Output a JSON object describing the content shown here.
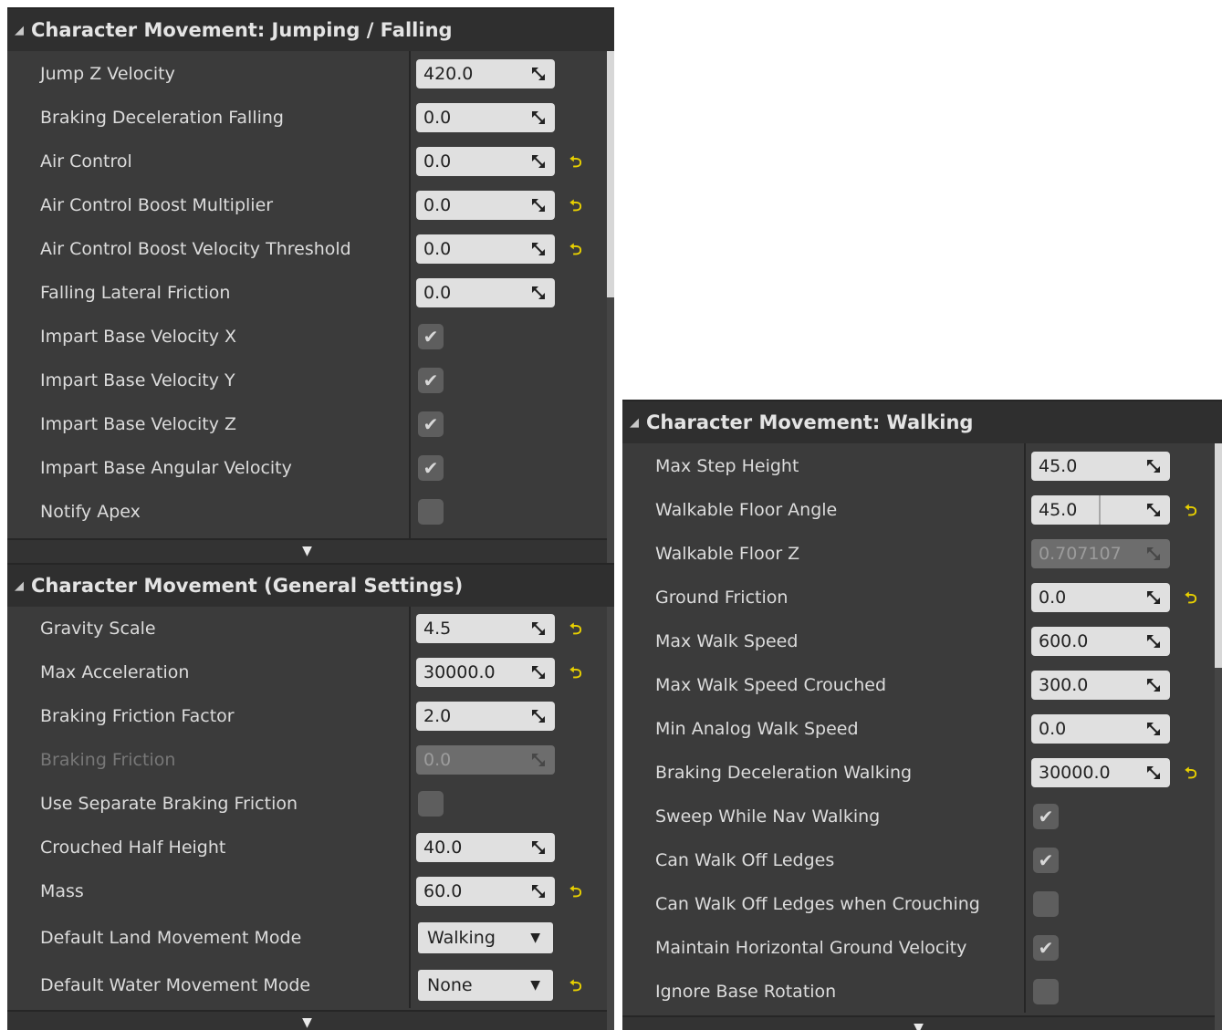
{
  "jumping": {
    "title": "Character Movement: Jumping / Falling",
    "rows": {
      "jump_z_velocity": {
        "label": "Jump Z Velocity",
        "value": "420.0"
      },
      "braking_decel_falling": {
        "label": "Braking Deceleration Falling",
        "value": "0.0"
      },
      "air_control": {
        "label": "Air Control",
        "value": "0.0"
      },
      "air_control_boost_mult": {
        "label": "Air Control Boost Multiplier",
        "value": "0.0"
      },
      "air_control_boost_vel": {
        "label": "Air Control Boost Velocity Threshold",
        "value": "0.0"
      },
      "falling_lateral_friction": {
        "label": "Falling Lateral Friction",
        "value": "0.0"
      },
      "impart_x": {
        "label": "Impart Base Velocity X",
        "checked": true
      },
      "impart_y": {
        "label": "Impart Base Velocity Y",
        "checked": true
      },
      "impart_z": {
        "label": "Impart Base Velocity Z",
        "checked": true
      },
      "impart_angular": {
        "label": "Impart Base Angular Velocity",
        "checked": true
      },
      "notify_apex": {
        "label": "Notify Apex",
        "checked": false
      }
    }
  },
  "general": {
    "title": "Character Movement (General Settings)",
    "rows": {
      "gravity_scale": {
        "label": "Gravity Scale",
        "value": "4.5"
      },
      "max_acceleration": {
        "label": "Max Acceleration",
        "value": "30000.0"
      },
      "braking_friction_factor": {
        "label": "Braking Friction Factor",
        "value": "2.0"
      },
      "braking_friction": {
        "label": "Braking Friction",
        "value": "0.0",
        "disabled": true
      },
      "use_separate_braking": {
        "label": "Use Separate Braking Friction",
        "checked": false
      },
      "crouched_half_height": {
        "label": "Crouched Half Height",
        "value": "40.0"
      },
      "mass": {
        "label": "Mass",
        "value": "60.0"
      },
      "default_land_mode": {
        "label": "Default Land Movement Mode",
        "value": "Walking"
      },
      "default_water_mode": {
        "label": "Default Water Movement Mode",
        "value": "None"
      }
    }
  },
  "walking": {
    "title": "Character Movement: Walking",
    "rows": {
      "max_step_height": {
        "label": "Max Step Height",
        "value": "45.0"
      },
      "walkable_floor_angle": {
        "label": "Walkable Floor Angle",
        "value": "45.0"
      },
      "walkable_floor_z": {
        "label": "Walkable Floor Z",
        "value": "0.707107",
        "disabled": true
      },
      "ground_friction": {
        "label": "Ground Friction",
        "value": "0.0"
      },
      "max_walk_speed": {
        "label": "Max Walk Speed",
        "value": "600.0"
      },
      "max_walk_speed_crouched": {
        "label": "Max Walk Speed Crouched",
        "value": "300.0"
      },
      "min_analog_walk_speed": {
        "label": "Min Analog Walk Speed",
        "value": "0.0"
      },
      "braking_decel_walking": {
        "label": "Braking Deceleration Walking",
        "value": "30000.0"
      },
      "sweep_nav_walking": {
        "label": "Sweep While Nav Walking",
        "checked": true
      },
      "can_walk_off_ledges": {
        "label": "Can Walk Off Ledges",
        "checked": true
      },
      "can_walk_off_crouching": {
        "label": "Can Walk Off Ledges when Crouching",
        "checked": false
      },
      "maintain_horizontal": {
        "label": "Maintain Horizontal Ground Velocity",
        "checked": true
      },
      "ignore_base_rotation": {
        "label": "Ignore Base Rotation",
        "checked": false
      }
    }
  },
  "icons": {
    "expand": "triangle-down-icon",
    "arrow": "drag-arrows-icon",
    "reset": "reset-to-default-icon",
    "check": "checkmark-icon",
    "caret": "dropdown-caret-icon"
  },
  "colors": {
    "accent_reset": "#e8d000",
    "panel": "#3b3b3b",
    "field": "#e0e0e0"
  }
}
